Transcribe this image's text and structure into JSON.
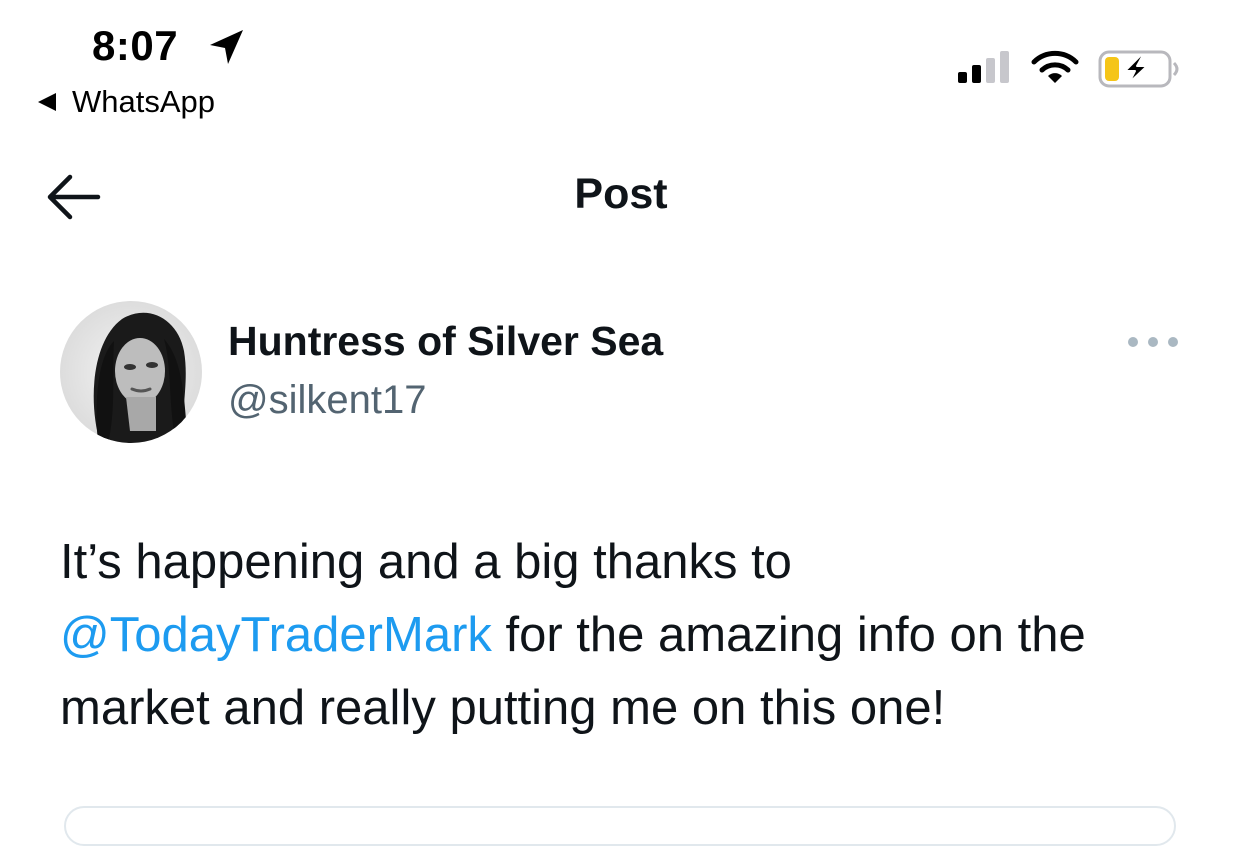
{
  "status_bar": {
    "time": "8:07",
    "back_app_label": "WhatsApp",
    "signal_bars_active": 2,
    "signal_bars_total": 4,
    "battery_level": 0.2,
    "battery_charging": true,
    "battery_color": "#f5c518"
  },
  "nav": {
    "title": "Post",
    "back_icon": "arrow-left-icon"
  },
  "post": {
    "author": {
      "display_name": "Huntress of Silver Sea",
      "handle": "@silkent17"
    },
    "text_part1": "It’s happening and a big thanks to ",
    "mention": "@TodayTraderMark",
    "text_part2": " for the amazing info on the market and really putting me on this one!",
    "more_icon": "more-options-icon"
  },
  "colors": {
    "text": "#0f1419",
    "secondary_text": "#536471",
    "link": "#1d9bf0"
  }
}
